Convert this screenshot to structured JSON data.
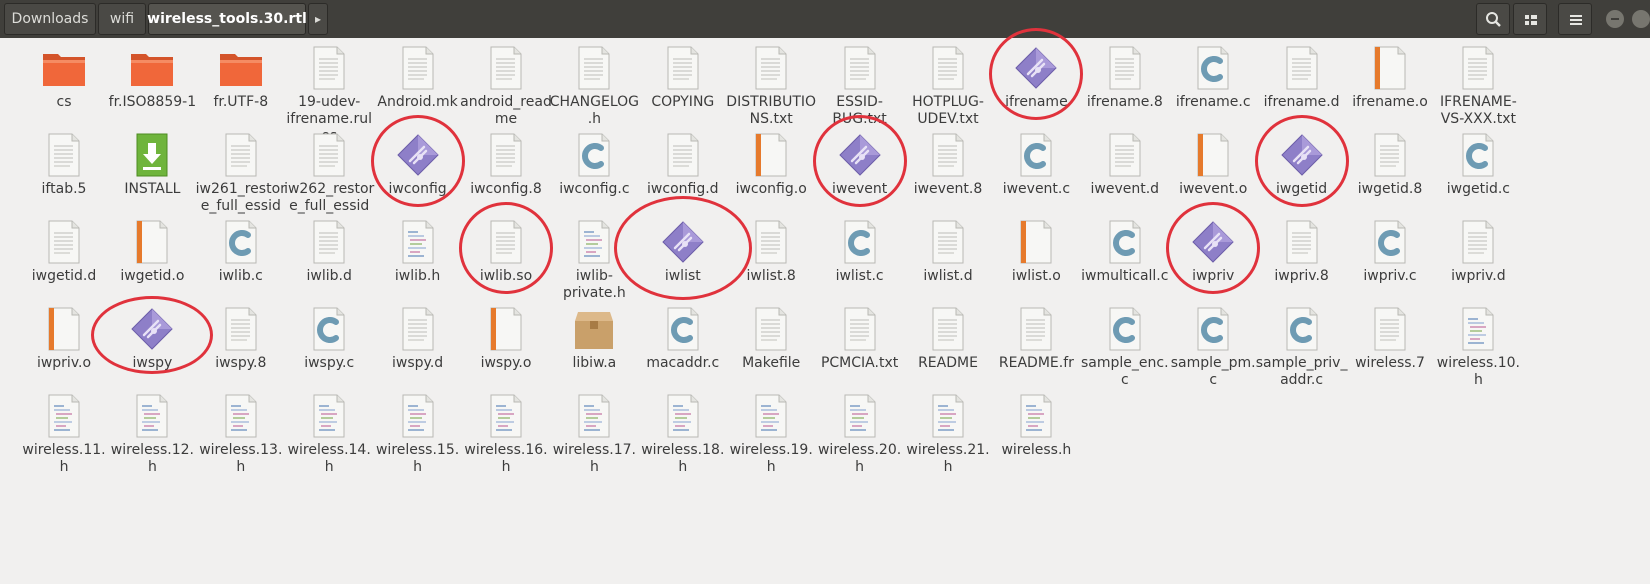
{
  "header": {
    "breadcrumbs": [
      "Downloads",
      "wifi",
      "wireless_tools.30.rtl"
    ],
    "more_arrow": "▸"
  },
  "files": [
    {
      "name": "cs",
      "icon": "folder"
    },
    {
      "name": "fr.ISO8859-1",
      "icon": "folder"
    },
    {
      "name": "fr.UTF-8",
      "icon": "folder"
    },
    {
      "name": "19-udev-ifrename.rules",
      "icon": "text"
    },
    {
      "name": "Android.mk",
      "icon": "text"
    },
    {
      "name": "android_readme",
      "icon": "text"
    },
    {
      "name": "CHANGELOG.h",
      "icon": "text"
    },
    {
      "name": "COPYING",
      "icon": "text"
    },
    {
      "name": "DISTRIBUTIONS.txt",
      "icon": "text"
    },
    {
      "name": "ESSID-BUG.txt",
      "icon": "text"
    },
    {
      "name": "HOTPLUG-UDEV.txt",
      "icon": "text"
    },
    {
      "name": "ifrename",
      "icon": "exec"
    },
    {
      "name": "ifrename.8",
      "icon": "text"
    },
    {
      "name": "ifrename.c",
      "icon": "c"
    },
    {
      "name": "ifrename.d",
      "icon": "text"
    },
    {
      "name": "ifrename.o",
      "icon": "object"
    },
    {
      "name": "IFRENAME-VS-XXX.txt",
      "icon": "text"
    },
    {
      "name": "iftab.5",
      "icon": "text"
    },
    {
      "name": "INSTALL",
      "icon": "install"
    },
    {
      "name": "iw261_restore_full_essid…",
      "icon": "text"
    },
    {
      "name": "iw262_restore_full_essid…",
      "icon": "text"
    },
    {
      "name": "iwconfig",
      "icon": "exec"
    },
    {
      "name": "iwconfig.8",
      "icon": "text"
    },
    {
      "name": "iwconfig.c",
      "icon": "c"
    },
    {
      "name": "iwconfig.d",
      "icon": "text"
    },
    {
      "name": "iwconfig.o",
      "icon": "object"
    },
    {
      "name": "iwevent",
      "icon": "exec"
    },
    {
      "name": "iwevent.8",
      "icon": "text"
    },
    {
      "name": "iwevent.c",
      "icon": "c"
    },
    {
      "name": "iwevent.d",
      "icon": "text"
    },
    {
      "name": "iwevent.o",
      "icon": "object"
    },
    {
      "name": "iwgetid",
      "icon": "exec"
    },
    {
      "name": "iwgetid.8",
      "icon": "text"
    },
    {
      "name": "iwgetid.c",
      "icon": "c"
    },
    {
      "name": "iwgetid.d",
      "icon": "text"
    },
    {
      "name": "iwgetid.o",
      "icon": "object"
    },
    {
      "name": "iwlib.c",
      "icon": "c"
    },
    {
      "name": "iwlib.d",
      "icon": "text"
    },
    {
      "name": "iwlib.h",
      "icon": "header"
    },
    {
      "name": "iwlib.so",
      "icon": "text"
    },
    {
      "name": "iwlib-private.h",
      "icon": "header"
    },
    {
      "name": "iwlist",
      "icon": "exec"
    },
    {
      "name": "iwlist.8",
      "icon": "text"
    },
    {
      "name": "iwlist.c",
      "icon": "c"
    },
    {
      "name": "iwlist.d",
      "icon": "text"
    },
    {
      "name": "iwlist.o",
      "icon": "object"
    },
    {
      "name": "iwmulticall.c",
      "icon": "c"
    },
    {
      "name": "iwpriv",
      "icon": "exec"
    },
    {
      "name": "iwpriv.8",
      "icon": "text"
    },
    {
      "name": "iwpriv.c",
      "icon": "c"
    },
    {
      "name": "iwpriv.d",
      "icon": "text"
    },
    {
      "name": "iwpriv.o",
      "icon": "object"
    },
    {
      "name": "iwspy",
      "icon": "exec"
    },
    {
      "name": "iwspy.8",
      "icon": "text"
    },
    {
      "name": "iwspy.c",
      "icon": "c"
    },
    {
      "name": "iwspy.d",
      "icon": "text"
    },
    {
      "name": "iwspy.o",
      "icon": "object"
    },
    {
      "name": "libiw.a",
      "icon": "archive"
    },
    {
      "name": "macaddr.c",
      "icon": "c"
    },
    {
      "name": "Makefile",
      "icon": "text"
    },
    {
      "name": "PCMCIA.txt",
      "icon": "text"
    },
    {
      "name": "README",
      "icon": "text"
    },
    {
      "name": "README.fr",
      "icon": "text"
    },
    {
      "name": "sample_enc.c",
      "icon": "c"
    },
    {
      "name": "sample_pm.c",
      "icon": "c"
    },
    {
      "name": "sample_priv_addr.c",
      "icon": "c"
    },
    {
      "name": "wireless.7",
      "icon": "text"
    },
    {
      "name": "wireless.10.h",
      "icon": "header"
    },
    {
      "name": "wireless.11.h",
      "icon": "header"
    },
    {
      "name": "wireless.12.h",
      "icon": "header"
    },
    {
      "name": "wireless.13.h",
      "icon": "header"
    },
    {
      "name": "wireless.14.h",
      "icon": "header"
    },
    {
      "name": "wireless.15.h",
      "icon": "header"
    },
    {
      "name": "wireless.16.h",
      "icon": "header"
    },
    {
      "name": "wireless.17.h",
      "icon": "header"
    },
    {
      "name": "wireless.18.h",
      "icon": "header"
    },
    {
      "name": "wireless.19.h",
      "icon": "header"
    },
    {
      "name": "wireless.20.h",
      "icon": "header"
    },
    {
      "name": "wireless.21.h",
      "icon": "header"
    },
    {
      "name": "wireless.h",
      "icon": "header"
    }
  ],
  "highlighted": [
    "ifrename",
    "iwconfig",
    "iwevent",
    "iwgetid",
    "iwlib.so",
    "iwlist",
    "iwpriv",
    "iwspy"
  ],
  "colors": {
    "header_bg": "#403f3b",
    "window_bg": "#f1f0ef",
    "folder": "#f0673a",
    "exec": "#8e7fc8",
    "c_icon": "#6e9bb3",
    "install": "#6fb43c",
    "archive": "#c9a06a",
    "highlight_ring": "#e0323c"
  }
}
